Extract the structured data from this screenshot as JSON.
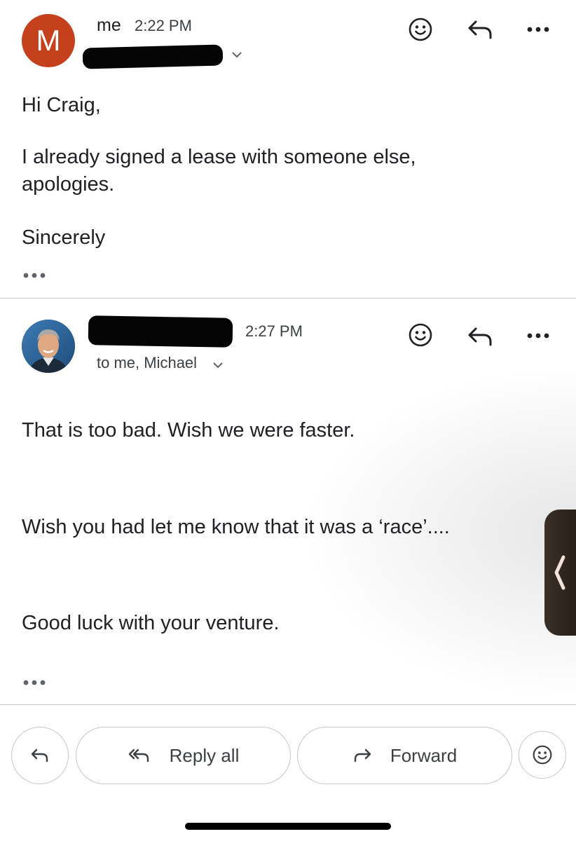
{
  "message1": {
    "avatar_letter": "M",
    "avatar_color": "#c5411d",
    "sender": "me",
    "time": "2:22 PM",
    "body": [
      "Hi Craig,",
      "I already signed a lease with someone else,",
      "apologies.",
      "Sincerely"
    ]
  },
  "message2": {
    "time": "2:27 PM",
    "recipients": "to me, Michael",
    "body": [
      "That is too bad.  Wish we were faster.",
      "Wish you had let me know that it was a ‘race’....",
      "Good luck with your venture."
    ]
  },
  "actions": {
    "reply_all": "Reply all",
    "forward": "Forward"
  },
  "icons": {
    "emoji": "smiley-icon",
    "reply": "reply-icon",
    "more": "more-horizontal-icon",
    "reply_all": "reply-all-icon",
    "forward": "forward-icon"
  }
}
